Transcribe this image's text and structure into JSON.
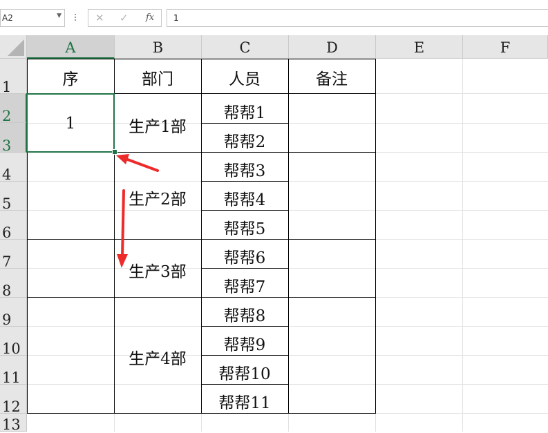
{
  "formula_bar": {
    "name_box": "A2",
    "cancel_icon": "✕",
    "enter_icon": "✓",
    "fx_label": "fx",
    "formula_value": "1"
  },
  "columns": [
    "A",
    "B",
    "C",
    "D",
    "E",
    "F"
  ],
  "rows": [
    "1",
    "2",
    "3",
    "4",
    "5",
    "6",
    "7",
    "8",
    "9",
    "10",
    "11",
    "12",
    "13"
  ],
  "selected_cell": "A2",
  "cells": {
    "header": {
      "A": "序",
      "B": "部门",
      "C": "人员",
      "D": "备注"
    },
    "seq": [
      "1"
    ],
    "departments": [
      "生产1部",
      "生产2部",
      "生产3部",
      "生产4部"
    ],
    "staff": [
      "帮帮1",
      "帮帮2",
      "帮帮3",
      "帮帮4",
      "帮帮5",
      "帮帮6",
      "帮帮7",
      "帮帮8",
      "帮帮9",
      "帮帮10",
      "帮帮11"
    ]
  },
  "colors": {
    "selection": "#217346",
    "arrow": "#ee2b2b"
  },
  "annotation_icons": [
    "red-arrow-diagonal-icon",
    "red-arrow-down-icon"
  ]
}
